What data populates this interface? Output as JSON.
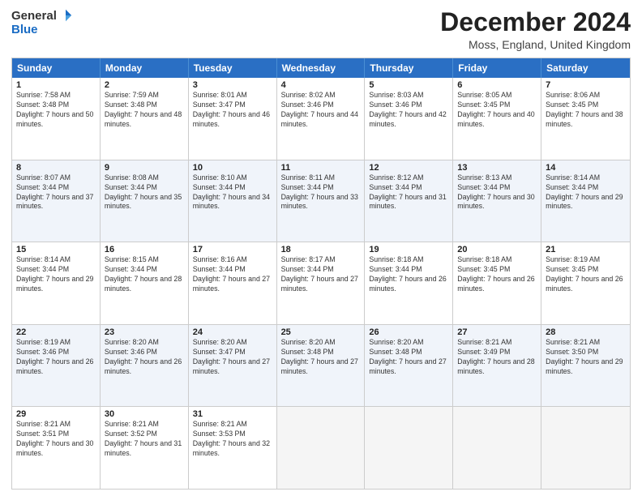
{
  "header": {
    "logo_general": "General",
    "logo_blue": "Blue",
    "title": "December 2024",
    "location": "Moss, England, United Kingdom"
  },
  "days": [
    "Sunday",
    "Monday",
    "Tuesday",
    "Wednesday",
    "Thursday",
    "Friday",
    "Saturday"
  ],
  "weeks": [
    [
      {
        "day": "1",
        "sunrise": "Sunrise: 7:58 AM",
        "sunset": "Sunset: 3:48 PM",
        "daylight": "Daylight: 7 hours and 50 minutes."
      },
      {
        "day": "2",
        "sunrise": "Sunrise: 7:59 AM",
        "sunset": "Sunset: 3:48 PM",
        "daylight": "Daylight: 7 hours and 48 minutes."
      },
      {
        "day": "3",
        "sunrise": "Sunrise: 8:01 AM",
        "sunset": "Sunset: 3:47 PM",
        "daylight": "Daylight: 7 hours and 46 minutes."
      },
      {
        "day": "4",
        "sunrise": "Sunrise: 8:02 AM",
        "sunset": "Sunset: 3:46 PM",
        "daylight": "Daylight: 7 hours and 44 minutes."
      },
      {
        "day": "5",
        "sunrise": "Sunrise: 8:03 AM",
        "sunset": "Sunset: 3:46 PM",
        "daylight": "Daylight: 7 hours and 42 minutes."
      },
      {
        "day": "6",
        "sunrise": "Sunrise: 8:05 AM",
        "sunset": "Sunset: 3:45 PM",
        "daylight": "Daylight: 7 hours and 40 minutes."
      },
      {
        "day": "7",
        "sunrise": "Sunrise: 8:06 AM",
        "sunset": "Sunset: 3:45 PM",
        "daylight": "Daylight: 7 hours and 38 minutes."
      }
    ],
    [
      {
        "day": "8",
        "sunrise": "Sunrise: 8:07 AM",
        "sunset": "Sunset: 3:44 PM",
        "daylight": "Daylight: 7 hours and 37 minutes."
      },
      {
        "day": "9",
        "sunrise": "Sunrise: 8:08 AM",
        "sunset": "Sunset: 3:44 PM",
        "daylight": "Daylight: 7 hours and 35 minutes."
      },
      {
        "day": "10",
        "sunrise": "Sunrise: 8:10 AM",
        "sunset": "Sunset: 3:44 PM",
        "daylight": "Daylight: 7 hours and 34 minutes."
      },
      {
        "day": "11",
        "sunrise": "Sunrise: 8:11 AM",
        "sunset": "Sunset: 3:44 PM",
        "daylight": "Daylight: 7 hours and 33 minutes."
      },
      {
        "day": "12",
        "sunrise": "Sunrise: 8:12 AM",
        "sunset": "Sunset: 3:44 PM",
        "daylight": "Daylight: 7 hours and 31 minutes."
      },
      {
        "day": "13",
        "sunrise": "Sunrise: 8:13 AM",
        "sunset": "Sunset: 3:44 PM",
        "daylight": "Daylight: 7 hours and 30 minutes."
      },
      {
        "day": "14",
        "sunrise": "Sunrise: 8:14 AM",
        "sunset": "Sunset: 3:44 PM",
        "daylight": "Daylight: 7 hours and 29 minutes."
      }
    ],
    [
      {
        "day": "15",
        "sunrise": "Sunrise: 8:14 AM",
        "sunset": "Sunset: 3:44 PM",
        "daylight": "Daylight: 7 hours and 29 minutes."
      },
      {
        "day": "16",
        "sunrise": "Sunrise: 8:15 AM",
        "sunset": "Sunset: 3:44 PM",
        "daylight": "Daylight: 7 hours and 28 minutes."
      },
      {
        "day": "17",
        "sunrise": "Sunrise: 8:16 AM",
        "sunset": "Sunset: 3:44 PM",
        "daylight": "Daylight: 7 hours and 27 minutes."
      },
      {
        "day": "18",
        "sunrise": "Sunrise: 8:17 AM",
        "sunset": "Sunset: 3:44 PM",
        "daylight": "Daylight: 7 hours and 27 minutes."
      },
      {
        "day": "19",
        "sunrise": "Sunrise: 8:18 AM",
        "sunset": "Sunset: 3:44 PM",
        "daylight": "Daylight: 7 hours and 26 minutes."
      },
      {
        "day": "20",
        "sunrise": "Sunrise: 8:18 AM",
        "sunset": "Sunset: 3:45 PM",
        "daylight": "Daylight: 7 hours and 26 minutes."
      },
      {
        "day": "21",
        "sunrise": "Sunrise: 8:19 AM",
        "sunset": "Sunset: 3:45 PM",
        "daylight": "Daylight: 7 hours and 26 minutes."
      }
    ],
    [
      {
        "day": "22",
        "sunrise": "Sunrise: 8:19 AM",
        "sunset": "Sunset: 3:46 PM",
        "daylight": "Daylight: 7 hours and 26 minutes."
      },
      {
        "day": "23",
        "sunrise": "Sunrise: 8:20 AM",
        "sunset": "Sunset: 3:46 PM",
        "daylight": "Daylight: 7 hours and 26 minutes."
      },
      {
        "day": "24",
        "sunrise": "Sunrise: 8:20 AM",
        "sunset": "Sunset: 3:47 PM",
        "daylight": "Daylight: 7 hours and 27 minutes."
      },
      {
        "day": "25",
        "sunrise": "Sunrise: 8:20 AM",
        "sunset": "Sunset: 3:48 PM",
        "daylight": "Daylight: 7 hours and 27 minutes."
      },
      {
        "day": "26",
        "sunrise": "Sunrise: 8:20 AM",
        "sunset": "Sunset: 3:48 PM",
        "daylight": "Daylight: 7 hours and 27 minutes."
      },
      {
        "day": "27",
        "sunrise": "Sunrise: 8:21 AM",
        "sunset": "Sunset: 3:49 PM",
        "daylight": "Daylight: 7 hours and 28 minutes."
      },
      {
        "day": "28",
        "sunrise": "Sunrise: 8:21 AM",
        "sunset": "Sunset: 3:50 PM",
        "daylight": "Daylight: 7 hours and 29 minutes."
      }
    ],
    [
      {
        "day": "29",
        "sunrise": "Sunrise: 8:21 AM",
        "sunset": "Sunset: 3:51 PM",
        "daylight": "Daylight: 7 hours and 30 minutes."
      },
      {
        "day": "30",
        "sunrise": "Sunrise: 8:21 AM",
        "sunset": "Sunset: 3:52 PM",
        "daylight": "Daylight: 7 hours and 31 minutes."
      },
      {
        "day": "31",
        "sunrise": "Sunrise: 8:21 AM",
        "sunset": "Sunset: 3:53 PM",
        "daylight": "Daylight: 7 hours and 32 minutes."
      },
      null,
      null,
      null,
      null
    ]
  ]
}
